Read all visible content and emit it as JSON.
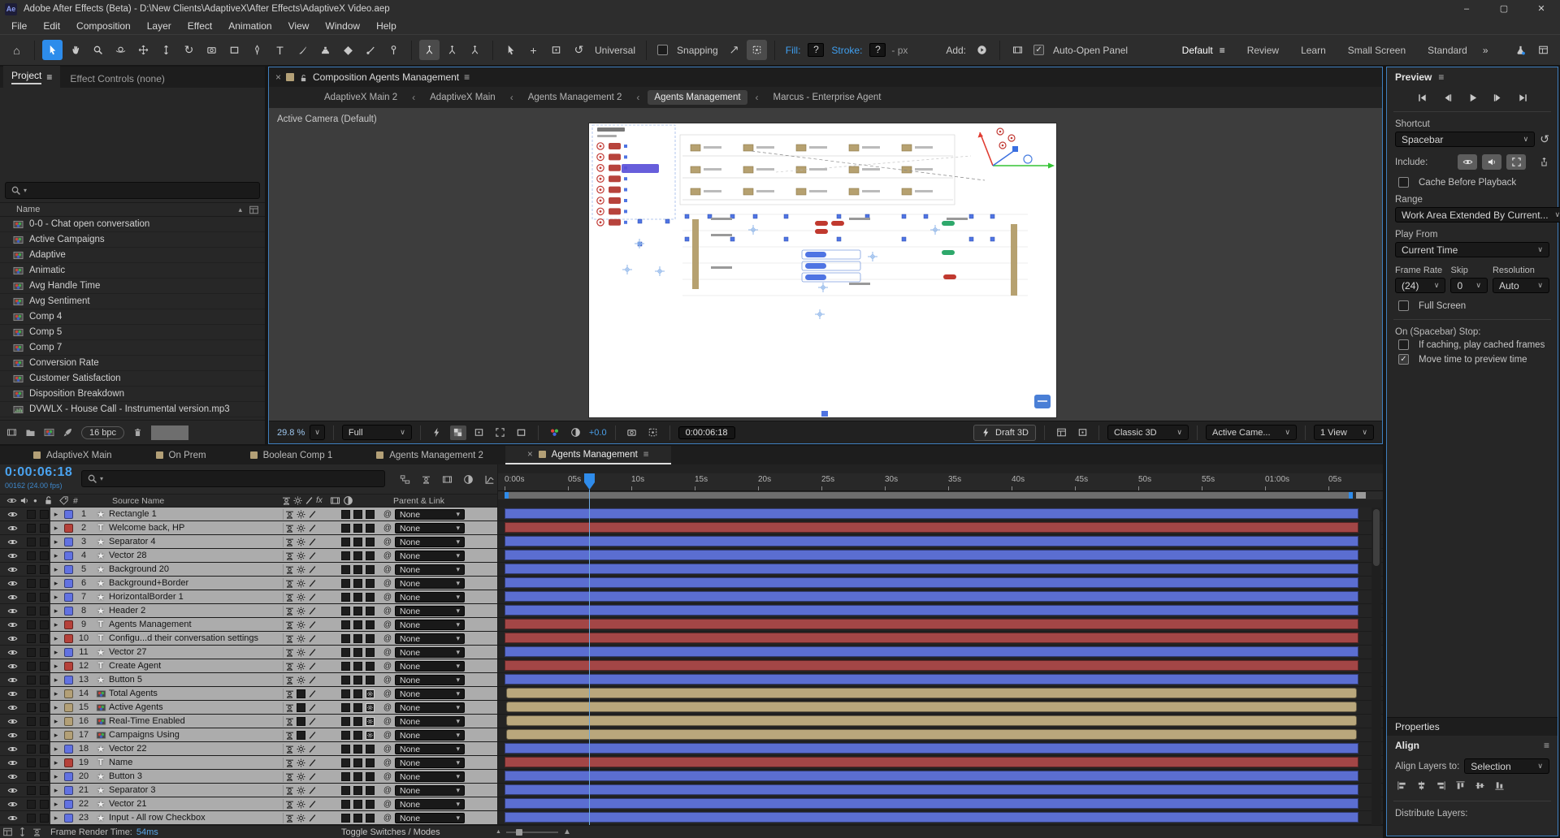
{
  "icons": {
    "minimize": "–",
    "maximize": "▢",
    "close": "✕",
    "close_small": "×",
    "hamburger": "≡",
    "chevron": "∨",
    "chevron_small": "▾",
    "breadcrumb_sep": "‹",
    "sort": "▴",
    "arrow": "▸",
    "star": "★",
    "text_tool": "T",
    "pickwhip": "@",
    "overflow": "»",
    "home": "⌂",
    "rotate_cw": "↻",
    "rotate_ccw": "↺",
    "eraser": "◆",
    "plus": "+",
    "hash": "#",
    "fx": "fx",
    "dot": "●",
    "mountain": "▲"
  },
  "titlebar": {
    "app_badge": "Ae",
    "title": "Adobe After Effects (Beta) - D:\\New Clients\\AdaptiveX\\After Effects\\AdaptiveX Video.aep"
  },
  "menubar": {
    "items": [
      "File",
      "Edit",
      "Composition",
      "Layer",
      "Effect",
      "Animation",
      "View",
      "Window",
      "Help"
    ]
  },
  "toolbar": {
    "universal": "Universal",
    "snapping": "Snapping",
    "fill_label": "Fill:",
    "fill_value": "?",
    "stroke_label": "Stroke:",
    "stroke_value": "?",
    "px_suffix": "- px",
    "add_label": "Add:",
    "auto_open_label": "Auto-Open Panel",
    "workspace_active": "Default",
    "workspaces": [
      "Review",
      "Learn",
      "Small Screen",
      "Standard"
    ]
  },
  "project": {
    "tab_project": "Project",
    "tab_effects": "Effect Controls (none)",
    "name_column": "Name",
    "bit_depth": "16 bpc",
    "items": [
      {
        "name": "0-0 - Chat open conversation",
        "type": "comp"
      },
      {
        "name": "Active Campaigns",
        "type": "comp"
      },
      {
        "name": "Adaptive",
        "type": "comp"
      },
      {
        "name": "Animatic",
        "type": "comp"
      },
      {
        "name": "Avg Handle Time",
        "type": "comp"
      },
      {
        "name": "Avg Sentiment",
        "type": "comp"
      },
      {
        "name": "Comp 4",
        "type": "comp"
      },
      {
        "name": "Comp 5",
        "type": "comp"
      },
      {
        "name": "Comp 7",
        "type": "comp"
      },
      {
        "name": "Conversion Rate",
        "type": "comp"
      },
      {
        "name": "Customer Satisfaction",
        "type": "comp"
      },
      {
        "name": "Disposition Breakdown",
        "type": "comp"
      },
      {
        "name": "DVWLX - House Call - Instrumental version.mp3",
        "type": "audio"
      }
    ]
  },
  "comp": {
    "tab_title": "Composition Agents Management",
    "breadcrumbs": [
      "AdaptiveX Main 2",
      "AdaptiveX Main",
      "Agents Management 2",
      "Agents Management",
      "Marcus - Enterprise Agent"
    ],
    "active_breadcrumb": "Agents Management",
    "camera_label": "Active Camera (Default)",
    "zoom_value": "29.8 %",
    "resolution_value": "Full",
    "exposure_value": "+0.0",
    "timecode": "0:00:06:18",
    "draft_3d": "Draft 3D",
    "renderer": "Classic 3D",
    "camera_view": "Active Came...",
    "view_count": "1 View"
  },
  "preview": {
    "title": "Preview",
    "shortcut_label": "Shortcut",
    "shortcut_value": "Spacebar",
    "include_label": "Include:",
    "cache_label": "Cache Before Playback",
    "range_label": "Range",
    "range_value": "Work Area Extended By Current...",
    "play_from_label": "Play From",
    "play_from_value": "Current Time",
    "frame_rate_label": "Frame Rate",
    "frame_rate_value": "(24)",
    "skip_label": "Skip",
    "skip_value": "0",
    "resolution_label": "Resolution",
    "resolution_value": "Auto",
    "full_screen_label": "Full Screen",
    "on_stop_label": "On (Spacebar) Stop:",
    "if_caching_label": "If caching, play cached frames",
    "move_time_label": "Move time to preview time"
  },
  "properties": {
    "title": "Properties",
    "align_title": "Align",
    "align_layers_label": "Align Layers to:",
    "align_value": "Selection",
    "distribute_label": "Distribute Layers:"
  },
  "timeline": {
    "tabs": [
      "AdaptiveX Main",
      "On Prem",
      "Boolean Comp 1",
      "Agents Management 2",
      "Agents Management"
    ],
    "active_tab": "Agents Management",
    "timecode": "0:00:06:18",
    "frame_info": "00162 (24.00 fps)",
    "source_column": "Source Name",
    "parent_column": "Parent & Link",
    "parent_value": "None",
    "ruler_ticks": [
      "0:00s",
      "05s",
      "10s",
      "15s",
      "20s",
      "25s",
      "30s",
      "35s",
      "40s",
      "45s",
      "50s",
      "55s",
      "01:00s",
      "05s"
    ],
    "layers": [
      {
        "num": 1,
        "name": "Rectangle 1",
        "type": "shape",
        "color": "blue"
      },
      {
        "num": 2,
        "name": "Welcome back, HP",
        "type": "text",
        "color": "red"
      },
      {
        "num": 3,
        "name": "Separator 4",
        "type": "shape",
        "color": "blue"
      },
      {
        "num": 4,
        "name": "Vector 28",
        "type": "shape",
        "color": "blue"
      },
      {
        "num": 5,
        "name": "Background 20",
        "type": "shape",
        "color": "blue"
      },
      {
        "num": 6,
        "name": "Background+Border",
        "type": "shape",
        "color": "blue"
      },
      {
        "num": 7,
        "name": "HorizontalBorder 1",
        "type": "shape",
        "color": "blue"
      },
      {
        "num": 8,
        "name": "Header 2",
        "type": "shape",
        "color": "blue"
      },
      {
        "num": 9,
        "name": "Agents Management",
        "type": "text",
        "color": "red"
      },
      {
        "num": 10,
        "name": "Configu...d their conversation settings",
        "type": "text",
        "color": "red"
      },
      {
        "num": 11,
        "name": "Vector 27",
        "type": "shape",
        "color": "blue"
      },
      {
        "num": 12,
        "name": "Create Agent",
        "type": "text",
        "color": "red"
      },
      {
        "num": 13,
        "name": "Button 5",
        "type": "shape",
        "color": "blue"
      },
      {
        "num": 14,
        "name": "Total Agents",
        "type": "comp",
        "color": "tan"
      },
      {
        "num": 15,
        "name": "Active Agents",
        "type": "comp",
        "color": "tan"
      },
      {
        "num": 16,
        "name": "Real-Time Enabled",
        "type": "comp",
        "color": "tan"
      },
      {
        "num": 17,
        "name": "Campaigns Using",
        "type": "comp",
        "color": "tan"
      },
      {
        "num": 18,
        "name": "Vector 22",
        "type": "shape",
        "color": "blue"
      },
      {
        "num": 19,
        "name": "Name",
        "type": "text",
        "color": "red"
      },
      {
        "num": 20,
        "name": "Button 3",
        "type": "shape",
        "color": "blue"
      },
      {
        "num": 21,
        "name": "Separator 3",
        "type": "shape",
        "color": "blue"
      },
      {
        "num": 22,
        "name": "Vector 21",
        "type": "shape",
        "color": "blue"
      },
      {
        "num": 23,
        "name": "Input - All row Checkbox",
        "type": "shape",
        "color": "blue"
      }
    ]
  },
  "statusbar": {
    "frame_render_label": "Frame Render Time:",
    "frame_render_value": "54ms",
    "toggle_label": "Toggle Switches / Modes"
  },
  "colors": {
    "accent_blue": "#2f8ceb",
    "timecode_blue": "#4aa3f0",
    "label_blue": "#6272e2",
    "label_red": "#b6413a",
    "label_tan": "#b3a077",
    "bar_blue": "#5b6ed1",
    "bar_red": "#a34646",
    "bar_tan": "#b9a77c"
  }
}
